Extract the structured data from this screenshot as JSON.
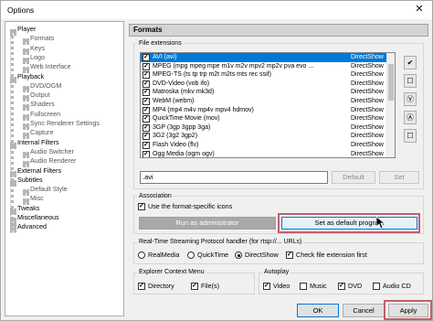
{
  "window": {
    "title": "Options",
    "close_glyph": "✕"
  },
  "tree": {
    "items": [
      {
        "label": "Player",
        "level": 0
      },
      {
        "label": "Formats",
        "level": 1
      },
      {
        "label": "Keys",
        "level": 1
      },
      {
        "label": "Logo",
        "level": 1
      },
      {
        "label": "Web Interface",
        "level": 1
      },
      {
        "label": "Playback",
        "level": 0
      },
      {
        "label": "DVD/OGM",
        "level": 1
      },
      {
        "label": "Output",
        "level": 1
      },
      {
        "label": "Shaders",
        "level": 1
      },
      {
        "label": "Fullscreen",
        "level": 1
      },
      {
        "label": "Sync Renderer Settings",
        "level": 1
      },
      {
        "label": "Capture",
        "level": 1
      },
      {
        "label": "Internal Filters",
        "level": 0
      },
      {
        "label": "Audio Switcher",
        "level": 1
      },
      {
        "label": "Audio Renderer",
        "level": 1
      },
      {
        "label": "External Filters",
        "level": 0
      },
      {
        "label": "Subtitles",
        "level": 0
      },
      {
        "label": "Default Style",
        "level": 1
      },
      {
        "label": "Misc",
        "level": 1
      },
      {
        "label": "Tweaks",
        "level": 0
      },
      {
        "label": "Miscellaneous",
        "level": 0
      },
      {
        "label": "Advanced",
        "level": 0
      }
    ]
  },
  "page": {
    "header": "Formats",
    "file_extensions_label": "File extensions",
    "formats": [
      {
        "name": "AVI (avi)",
        "type": "DirectShow",
        "selected": true
      },
      {
        "name": "MPEG (mpg mpeg mpe m1v m2v mpv2 mp2v pva evo ...",
        "type": "DirectShow"
      },
      {
        "name": "MPEG-TS (ts tp trp m2t m2ts mts rec ssif)",
        "type": "DirectShow"
      },
      {
        "name": "DVD-Video (vob ifo)",
        "type": "DirectShow"
      },
      {
        "name": "Matroska (mkv mk3d)",
        "type": "DirectShow"
      },
      {
        "name": "WebM (webm)",
        "type": "DirectShow"
      },
      {
        "name": "MP4 (mp4 m4v mp4v mpv4 hdmov)",
        "type": "DirectShow"
      },
      {
        "name": "QuickTime Movie (mov)",
        "type": "DirectShow"
      },
      {
        "name": "3GP (3gp 3gpp 3ga)",
        "type": "DirectShow"
      },
      {
        "name": "3G2 (3g2 3gp2)",
        "type": "DirectShow"
      },
      {
        "name": "Flash Video (flv)",
        "type": "DirectShow"
      },
      {
        "name": "Ogg Media (ogm ogv)",
        "type": "DirectShow"
      }
    ],
    "side_buttons": [
      "✔",
      "☐",
      "Ⓥ",
      "Ⓐ",
      "☐"
    ],
    "ext_value": ".avi",
    "default_btn": "Default",
    "set_btn": "Set",
    "association_label": "Association",
    "use_icons_label": "Use the format-specific icons",
    "run_admin_btn": "Run as administrator",
    "set_default_btn": "Set as default program",
    "rtsp_label": "Real-Time Streaming Protocol handler (for rtsp://... URLs)",
    "rtsp_options": [
      "RealMedia",
      "QuickTime",
      "DirectShow"
    ],
    "rtsp_selected": "DirectShow",
    "check_ext_label": "Check file extension first",
    "explorer_label": "Explorer Context Menu",
    "explorer_items": [
      "Directory",
      "File(s)"
    ],
    "autoplay_label": "Autoplay",
    "autoplay_items": [
      {
        "label": "Video",
        "checked": true
      },
      {
        "label": "Music",
        "checked": false
      },
      {
        "label": "DVD",
        "checked": true
      },
      {
        "label": "Audio CD",
        "checked": false
      }
    ]
  },
  "buttons": {
    "ok": "OK",
    "cancel": "Cancel",
    "apply": "Apply"
  },
  "colors": {
    "selection": "#0078d7",
    "highlight_box": "#c0606a"
  }
}
